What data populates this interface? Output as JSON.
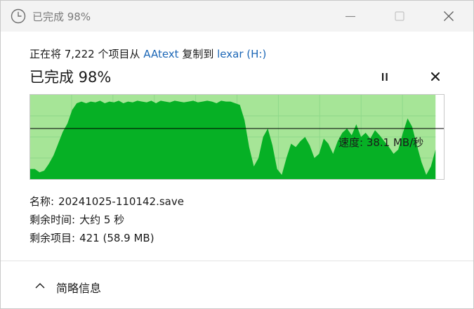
{
  "window": {
    "title": "已完成 98%",
    "icon": "clock-icon",
    "controls": [
      "minimize-icon",
      "maximize-icon",
      "close-icon"
    ]
  },
  "copy": {
    "prefix": "正在将 7,222 个项目从",
    "source": "AAtext",
    "middle": "复制到",
    "destination": "lexar (H:)"
  },
  "progress": {
    "title": "已完成 98%",
    "percent": 98,
    "pause_icon": "pause-icon",
    "cancel_icon": "close-icon"
  },
  "chart_data": {
    "type": "area",
    "speed_label": "速度: 38.1 MB/秒",
    "progress_fraction": 0.98,
    "current_speed_fraction": 0.6,
    "colors": {
      "remaining": "#a6e597",
      "transferred": "#06b025",
      "grid": "#8fd88a",
      "line": "#000000"
    },
    "values": [
      0.12,
      0.12,
      0.08,
      0.1,
      0.18,
      0.28,
      0.42,
      0.56,
      0.66,
      0.82,
      0.9,
      0.92,
      0.9,
      0.92,
      0.91,
      0.93,
      0.9,
      0.92,
      0.91,
      0.93,
      0.9,
      0.92,
      0.91,
      0.93,
      0.92,
      0.91,
      0.93,
      0.9,
      0.93,
      0.92,
      0.91,
      0.93,
      0.92,
      0.91,
      0.92,
      0.93,
      0.91,
      0.92,
      0.93,
      0.92,
      0.9,
      0.93,
      0.92,
      0.92,
      0.9,
      0.88,
      0.7,
      0.38,
      0.15,
      0.25,
      0.5,
      0.6,
      0.4,
      0.12,
      0.05,
      0.25,
      0.42,
      0.38,
      0.45,
      0.5,
      0.4,
      0.25,
      0.3,
      0.48,
      0.42,
      0.3,
      0.45,
      0.55,
      0.6,
      0.52,
      0.65,
      0.5,
      0.55,
      0.48,
      0.58,
      0.52,
      0.45,
      0.38,
      0.3,
      0.35,
      0.55,
      0.72,
      0.62,
      0.4,
      0.2,
      0.05,
      0.15,
      0.35
    ]
  },
  "details": {
    "name_label": "名称:",
    "name_value": "20241025-110142.save",
    "time_label": "剩余时间:",
    "time_value": "大约 5 秒",
    "items_label": "剩余项目:",
    "items_value": "421 (58.9 MB)"
  },
  "footer": {
    "less_info": "简略信息",
    "chevron": "chevron-up-icon"
  }
}
